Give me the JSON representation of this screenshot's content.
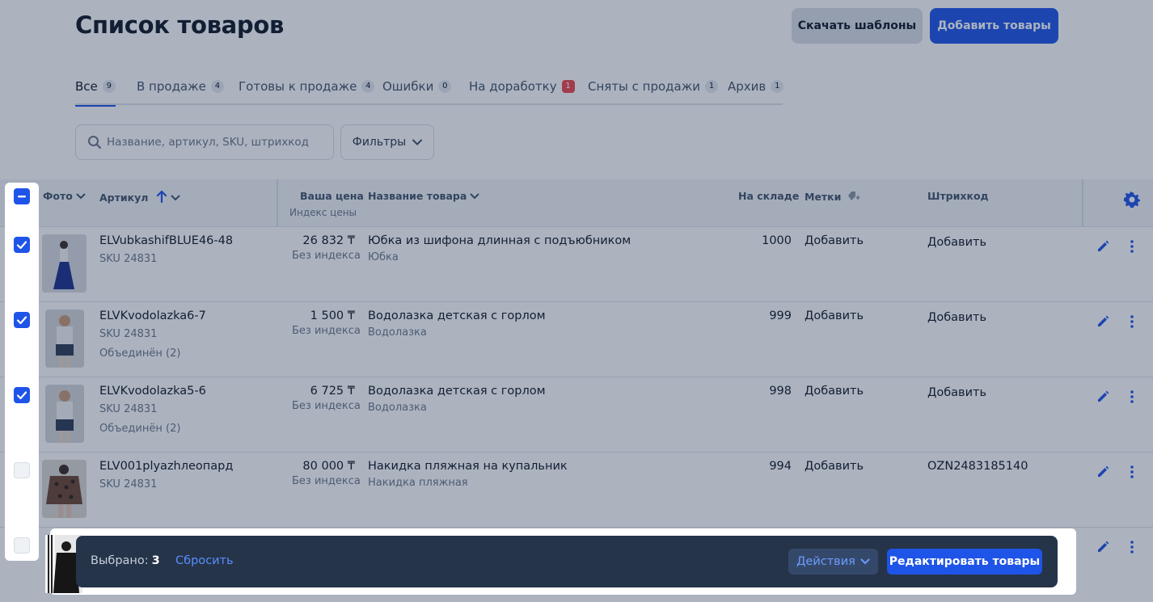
{
  "header": {
    "title": "Список товаров",
    "download_templates": "Скачать шаблоны",
    "add_products": "Добавить товары"
  },
  "tabs": [
    {
      "label": "Все",
      "count": "9",
      "active": true
    },
    {
      "label": "В продаже",
      "count": "4"
    },
    {
      "label": "Готовы к продаже",
      "count": "4"
    },
    {
      "label": "Ошибки",
      "count": "0"
    },
    {
      "label": "На доработку",
      "count": "1",
      "alert": true
    },
    {
      "label": "Сняты с продажи",
      "count": "1"
    },
    {
      "label": "Архив",
      "count": "1"
    }
  ],
  "search": {
    "placeholder": "Название, артикул, SKU, штрихкод",
    "value": ""
  },
  "filters": {
    "label": "Фильтры"
  },
  "table": {
    "columns": {
      "photo": "Фото",
      "article": "Артикул",
      "price": "Ваша цена",
      "price_index": "Индекс цены",
      "name": "Название товара",
      "stock": "На складе",
      "tags": "Метки",
      "barcode": "Штрихкод"
    },
    "rows": [
      {
        "article": "ELVubkashifBLUE46-48",
        "sku": "SKU 24831",
        "merged": "",
        "price": "26 832 ₸",
        "price_index": "Без индекса",
        "name": "Юбка из шифона длинная с подъюбником",
        "category": "Юбка",
        "stock": "1000",
        "tags": "Добавить",
        "barcode": "Добавить",
        "checked": true
      },
      {
        "article": "ELVKvodolazka6-7",
        "sku": "SKU 24831",
        "merged": "Объединён (2)",
        "price": "1 500 ₸",
        "price_index": "Без индекса",
        "name": "Водолазка детская с горлом",
        "category": "Водолазка",
        "stock": "999",
        "tags": "Добавить",
        "barcode": "Добавить",
        "checked": true
      },
      {
        "article": "ELVKvodolazka5-6",
        "sku": "SKU 24831",
        "merged": "Объединён (2)",
        "price": "6 725 ₸",
        "price_index": "Без индекса",
        "name": "Водолазка детская с горлом",
        "category": "Водолазка",
        "stock": "998",
        "tags": "Добавить",
        "barcode": "Добавить",
        "checked": true
      },
      {
        "article": "ELV001plyazhлеопард",
        "sku": "SKU 24831",
        "merged": "",
        "price": "80 000 ₸",
        "price_index": "Без индекса",
        "name": "Накидка пляжная на купальник",
        "category": "Накидка пляжная",
        "stock": "994",
        "tags": "Добавить",
        "barcode": "OZN2483185140",
        "checked": false
      }
    ]
  },
  "bulk_bar": {
    "selected_label": "Выбрано:",
    "selected_count": "3",
    "reset": "Сбросить",
    "actions": "Действия",
    "edit": "Редактировать товары"
  },
  "colors": {
    "accent": "#1f54e8",
    "overlay": "#182c4e",
    "bar": "#253449"
  }
}
